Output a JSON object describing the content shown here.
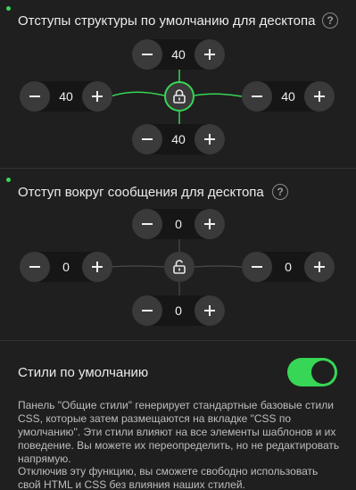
{
  "structure_section": {
    "title": "Отступы структуры по умолчанию для десктопа",
    "help": "?",
    "top": "40",
    "left": "40",
    "right": "40",
    "bottom": "40",
    "locked": true
  },
  "message_section": {
    "title": "Отступ вокруг сообщения для десктопа",
    "help": "?",
    "top": "0",
    "left": "0",
    "right": "0",
    "bottom": "0",
    "locked": false
  },
  "default_styles": {
    "label": "Стили по умолчанию",
    "enabled": true,
    "description_1": "Панель \"Общие стили\" генерирует стандартные базовые стили CSS, которые затем размещаются на вкладке \"CSS по умолчанию\". Эти стили влияют на все элементы шаблонов и их поведение. Вы можете их переопределить, но не редактировать напрямую.",
    "description_2": "Отключив эту функцию, вы сможете свободно использовать свой HTML и CSS без влияния наших стилей."
  },
  "colors": {
    "accent": "#38d656",
    "background": "#1f1f1f",
    "button": "#3a3a3a"
  }
}
